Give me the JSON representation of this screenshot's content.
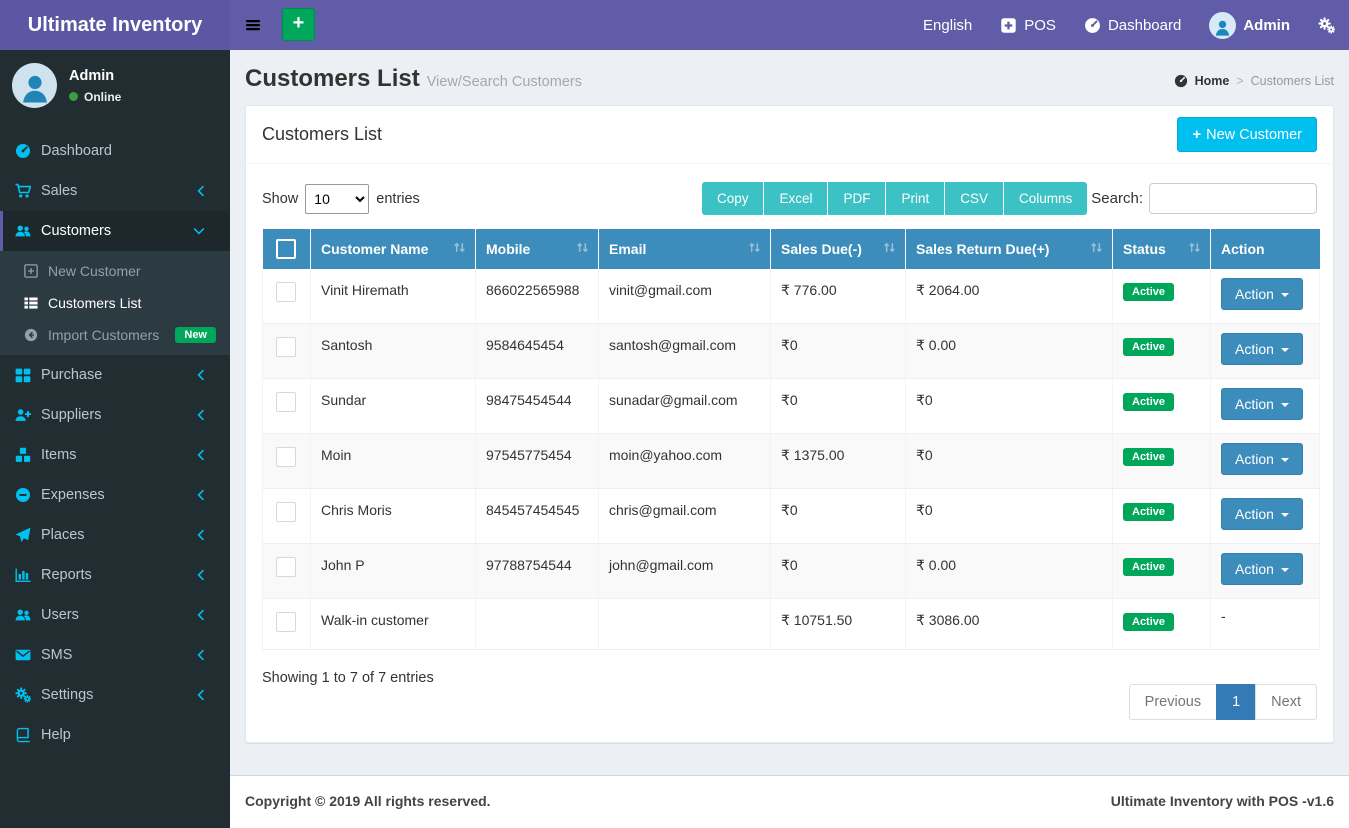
{
  "navbar": {
    "brand": "Ultimate Inventory",
    "language": "English",
    "pos": "POS",
    "dashboard": "Dashboard",
    "user": "Admin"
  },
  "sidebar": {
    "user_name": "Admin",
    "user_status": "Online",
    "items": [
      {
        "label": "Dashboard"
      },
      {
        "label": "Sales"
      },
      {
        "label": "Customers",
        "children": [
          {
            "label": "New Customer"
          },
          {
            "label": "Customers List"
          },
          {
            "label": "Import Customers",
            "badge": "New"
          }
        ]
      },
      {
        "label": "Purchase"
      },
      {
        "label": "Suppliers"
      },
      {
        "label": "Items"
      },
      {
        "label": "Expenses"
      },
      {
        "label": "Places"
      },
      {
        "label": "Reports"
      },
      {
        "label": "Users"
      },
      {
        "label": "SMS"
      },
      {
        "label": "Settings"
      },
      {
        "label": "Help"
      }
    ]
  },
  "page": {
    "title": "Customers List",
    "subtitle": "View/Search Customers",
    "breadcrumb_home": "Home",
    "breadcrumb_separator": ">",
    "breadcrumb_current": "Customers List"
  },
  "card": {
    "title": "Customers List",
    "new_button": "New Customer",
    "show_label": "Show",
    "page_length": "10",
    "entries_label": "entries",
    "export_buttons": [
      "Copy",
      "Excel",
      "PDF",
      "Print",
      "CSV",
      "Columns"
    ],
    "search_label": "Search:",
    "info": "Showing 1 to 7 of 7 entries",
    "pagination": {
      "previous": "Previous",
      "current": "1",
      "next": "Next"
    }
  },
  "table": {
    "columns": [
      "Customer Name",
      "Mobile",
      "Email",
      "Sales Due(-)",
      "Sales Return Due(+)",
      "Status",
      "Action"
    ],
    "rows": [
      {
        "name": "Vinit Hiremath",
        "mobile": "866022565988",
        "email": "vinit@gmail.com",
        "sales_due": "₹ 776.00",
        "sales_return_due": "₹ 2064.00",
        "status": "Active",
        "action": "Action"
      },
      {
        "name": "Santosh",
        "mobile": "9584645454",
        "email": "santosh@gmail.com",
        "sales_due": "₹0",
        "sales_return_due": "₹ 0.00",
        "status": "Active",
        "action": "Action"
      },
      {
        "name": "Sundar",
        "mobile": "98475454544",
        "email": "sunadar@gmail.com",
        "sales_due": "₹0",
        "sales_return_due": "₹0",
        "status": "Active",
        "action": "Action"
      },
      {
        "name": "Moin",
        "mobile": "97545775454",
        "email": "moin@yahoo.com",
        "sales_due": "₹ 1375.00",
        "sales_return_due": "₹0",
        "status": "Active",
        "action": "Action"
      },
      {
        "name": "Chris Moris",
        "mobile": "845457454545",
        "email": "chris@gmail.com",
        "sales_due": "₹0",
        "sales_return_due": "₹0",
        "status": "Active",
        "action": "Action"
      },
      {
        "name": "John P",
        "mobile": "97788754544",
        "email": "john@gmail.com",
        "sales_due": "₹0",
        "sales_return_due": "₹ 0.00",
        "status": "Active",
        "action": "Action"
      },
      {
        "name": "Walk-in customer",
        "mobile": "",
        "email": "",
        "sales_due": "₹ 10751.50",
        "sales_return_due": "₹ 3086.00",
        "status": "Active",
        "no_action": "-"
      }
    ]
  },
  "footer": {
    "copyright": "Copyright © 2019 All rights reserved.",
    "version": "Ultimate Inventory with POS -v1.6"
  },
  "colors": {
    "navbar_purple": "#605ca8",
    "sidebar_dark": "#222d32",
    "table_header_blue": "#3c8dbc",
    "info_cyan": "#00c0ef",
    "export_teal": "#3cc2c5",
    "success_green": "#00a65a",
    "pagination_active_blue": "#337ab7",
    "page_background": "#ecf0f5"
  }
}
